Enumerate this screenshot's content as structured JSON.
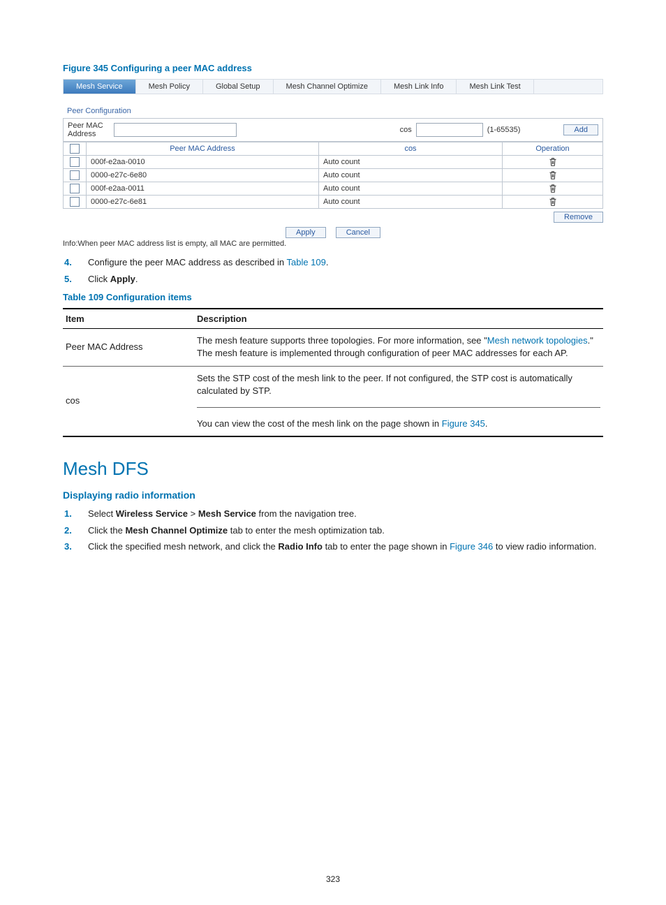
{
  "figure": {
    "caption": "Figure 345 Configuring a peer MAC address"
  },
  "app": {
    "tabs": [
      "Mesh Service",
      "Mesh Policy",
      "Global Setup",
      "Mesh Channel Optimize",
      "Mesh Link Info",
      "Mesh Link Test"
    ],
    "active_tab": 0,
    "peer_config_title": "Peer Configuration",
    "form": {
      "peer_mac_label": "Peer MAC Address",
      "peer_mac_value": "",
      "cos_label": "cos",
      "cos_value": "",
      "cos_range": "(1-65535)",
      "add_btn": "Add"
    },
    "grid": {
      "headers": [
        "",
        "Peer MAC Address",
        "cos",
        "Operation"
      ],
      "rows": [
        {
          "mac": "000f-e2aa-0010",
          "cos": "Auto count"
        },
        {
          "mac": "0000-e27c-6e80",
          "cos": "Auto count"
        },
        {
          "mac": "000f-e2aa-0011",
          "cos": "Auto count"
        },
        {
          "mac": "0000-e27c-6e81",
          "cos": "Auto count"
        }
      ]
    },
    "remove_btn": "Remove",
    "apply_btn": "Apply",
    "cancel_btn": "Cancel",
    "info_line": "Info:When peer MAC address list is empty, all MAC are permitted."
  },
  "steps_a": {
    "s4_pre": "Configure the peer MAC address as described in ",
    "s4_link": "Table 109",
    "s4_post": ".",
    "s5_pre": "Click ",
    "s5_bold": "Apply",
    "s5_post": "."
  },
  "table109": {
    "caption": "Table 109 Configuration items",
    "head_item": "Item",
    "head_desc": "Description",
    "rows": [
      {
        "item": "Peer MAC Address",
        "desc_pre": "The mesh feature supports three topologies. For more information, see \"",
        "desc_link": "Mesh network topologies",
        "desc_post": ".\" The mesh feature is implemented through configuration of peer MAC addresses for each AP."
      },
      {
        "item": "cos",
        "desc_para1": "Sets the STP cost of the mesh link to the peer. If not configured, the STP cost is automatically calculated by STP.",
        "desc_para2_pre": "You can view the cost of the mesh link on the page shown in ",
        "desc_para2_link": "Figure 345",
        "desc_para2_post": "."
      }
    ]
  },
  "section": {
    "heading": "Mesh DFS",
    "sub": "Displaying radio information",
    "steps": {
      "s1_pre": "Select ",
      "s1_b1": "Wireless Service",
      "s1_gt": " > ",
      "s1_b2": "Mesh Service",
      "s1_post": " from the navigation tree.",
      "s2_pre": "Click the ",
      "s2_b": "Mesh Channel Optimize",
      "s2_post": " tab to enter the mesh optimization tab.",
      "s3_pre": "Click the specified mesh network, and click the ",
      "s3_b": "Radio Info",
      "s3_mid": " tab to enter the page shown in ",
      "s3_link": "Figure 346",
      "s3_post": " to view radio information."
    }
  },
  "page_number": "323"
}
